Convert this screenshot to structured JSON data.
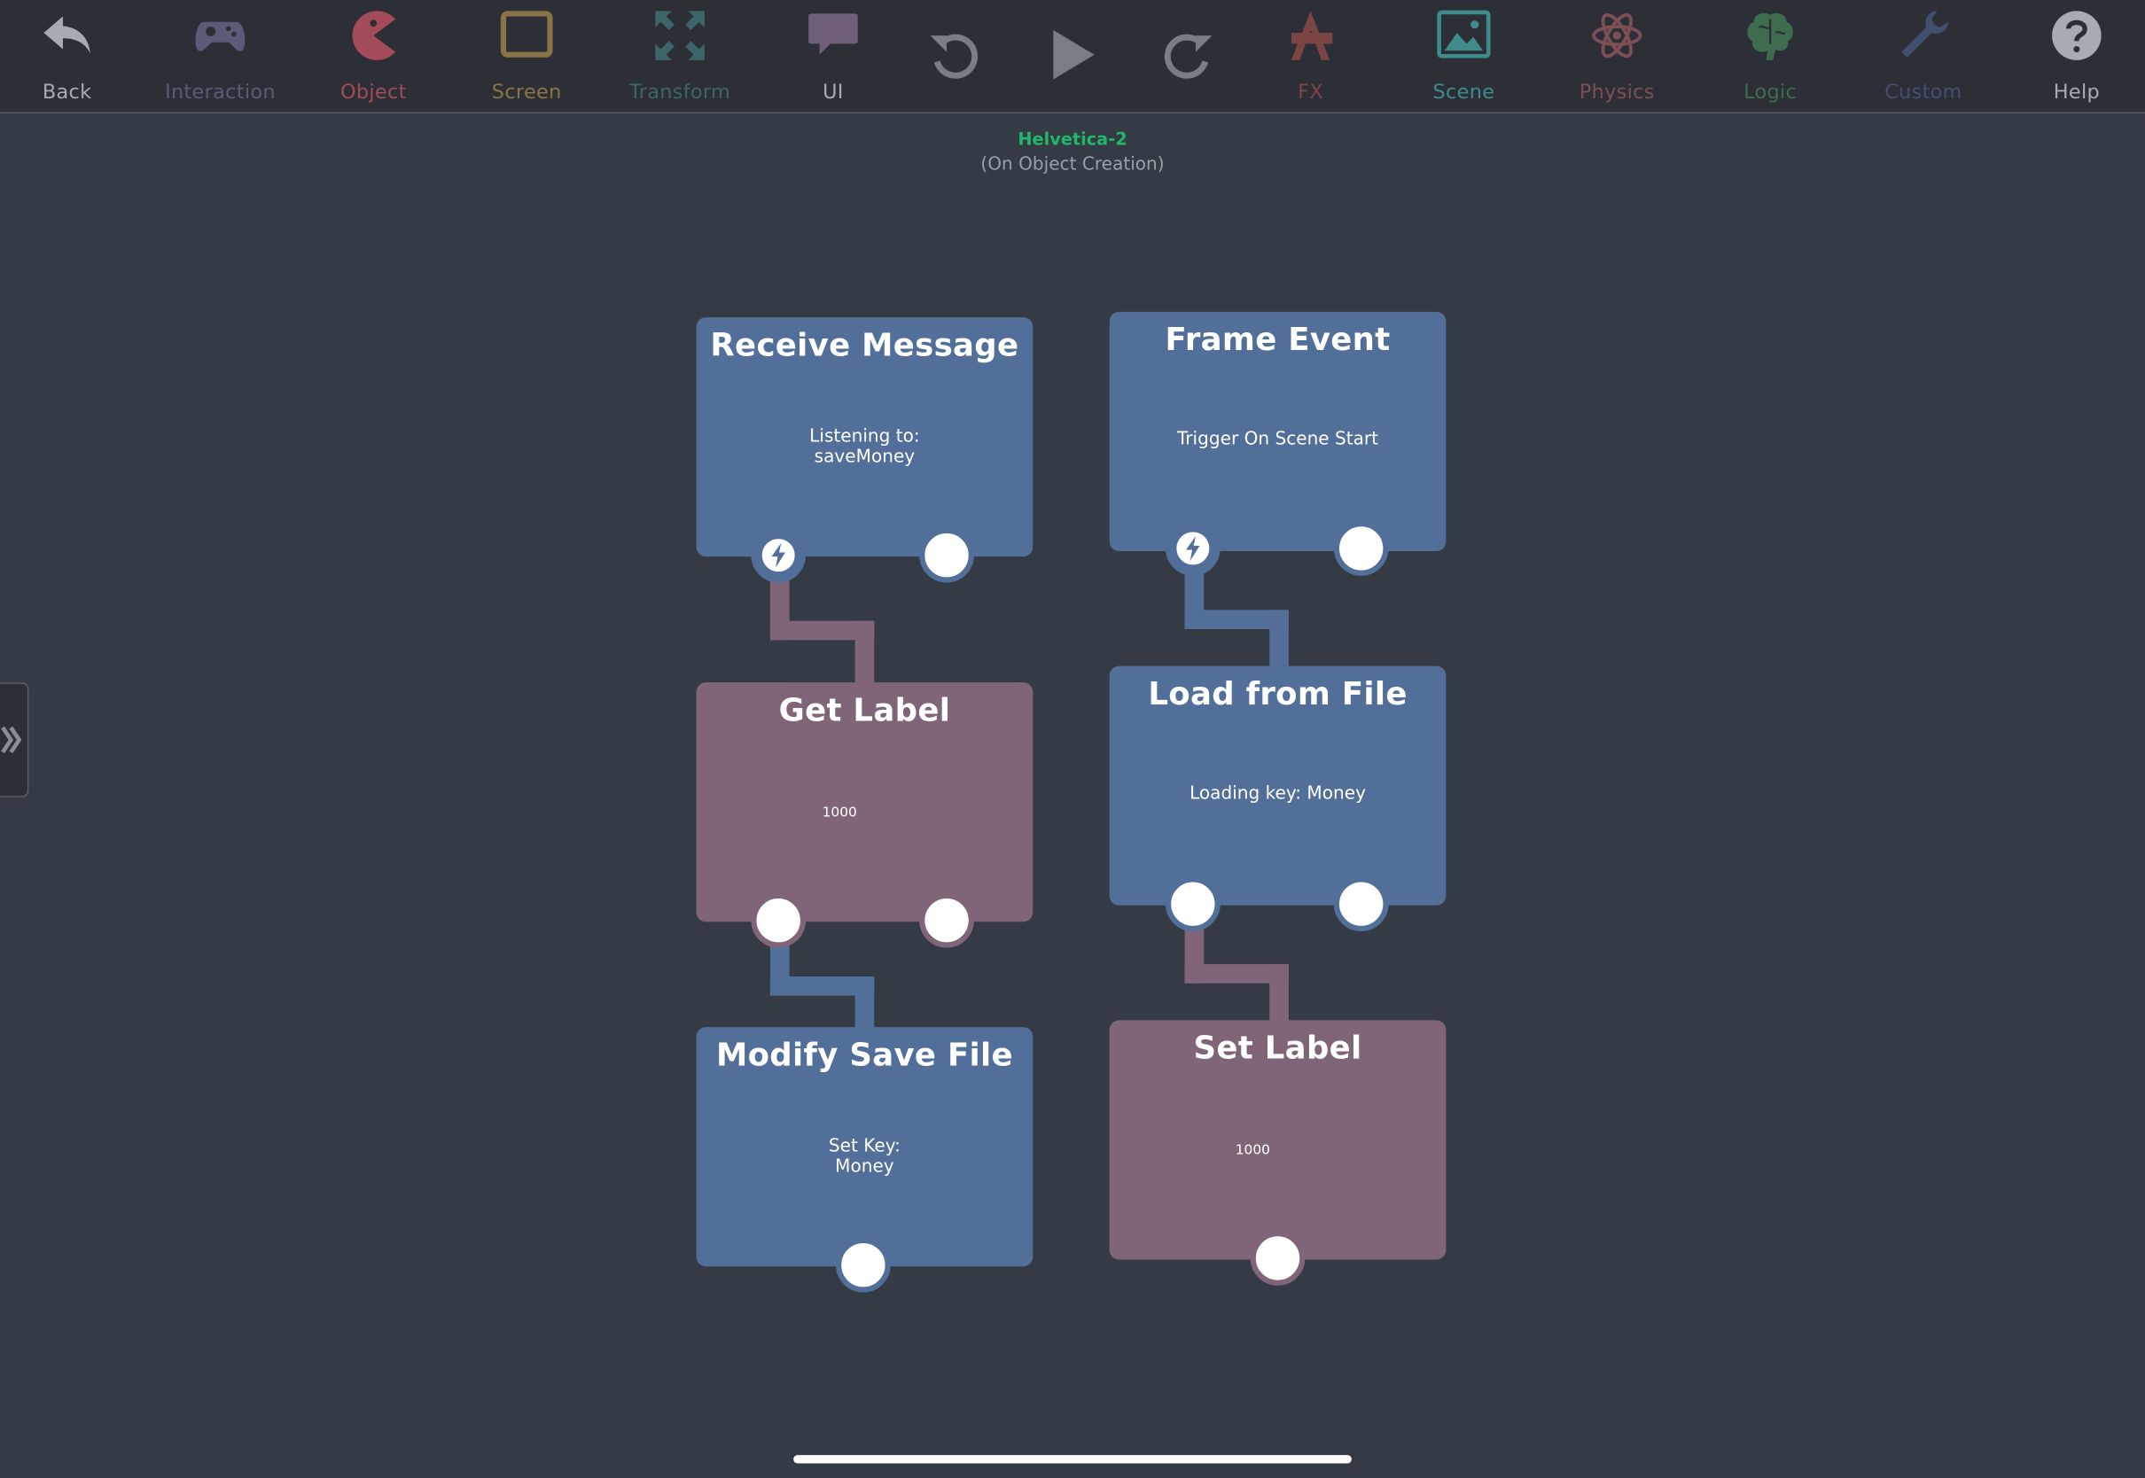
{
  "toolbar": {
    "items": [
      {
        "label": "Back",
        "icon": "back-arrow-icon",
        "color": "#a8acb2"
      },
      {
        "label": "Interaction",
        "icon": "gamepad-icon",
        "color": "#5b5a77"
      },
      {
        "label": "Object",
        "icon": "pacman-icon",
        "color": "#a34b59"
      },
      {
        "label": "Screen",
        "icon": "tablet-icon",
        "color": "#8a7346"
      },
      {
        "label": "Transform",
        "icon": "expand-arrows-icon",
        "color": "#3f6468"
      },
      {
        "label": "UI",
        "icon": "speech-bubble-icon",
        "color": "#a8acb2"
      },
      {
        "label": "FX",
        "icon": "fx-icon",
        "color": "#7c4544"
      },
      {
        "label": "Scene",
        "icon": "landscape-image-icon",
        "color": "#3f8a8a"
      },
      {
        "label": "Physics",
        "icon": "atom-icon",
        "color": "#7c4f55"
      },
      {
        "label": "Logic",
        "icon": "brain-icon",
        "color": "#3f6b4e"
      },
      {
        "label": "Custom",
        "icon": "wrench-icon",
        "color": "#40506e"
      },
      {
        "label": "Help",
        "icon": "question-circle-icon",
        "color": "#a8acb2"
      }
    ],
    "controls": {
      "undo": "undo-icon",
      "play": "play-icon",
      "redo": "redo-icon"
    }
  },
  "header": {
    "object_name": "Helvetica-2",
    "event_name": "(On Object Creation)"
  },
  "nodes": {
    "receive_message": {
      "title": "Receive Message",
      "body": "Listening to:\nsaveMoney"
    },
    "frame_event": {
      "title": "Frame Event",
      "body": "Trigger On Scene Start"
    },
    "get_label": {
      "title": "Get Label",
      "body": "1000"
    },
    "load_from_file": {
      "title": "Load from File",
      "body": "Loading key: Money"
    },
    "modify_save_file": {
      "title": "Modify Save File",
      "body": "Set Key:\nMoney"
    },
    "set_label": {
      "title": "Set Label",
      "body": "1000"
    }
  },
  "colors": {
    "background": "#353b44",
    "toolbar": "#2c3036",
    "node_blue": "#526f99",
    "node_mauve": "#806579",
    "object_name": "#1fb86a"
  }
}
